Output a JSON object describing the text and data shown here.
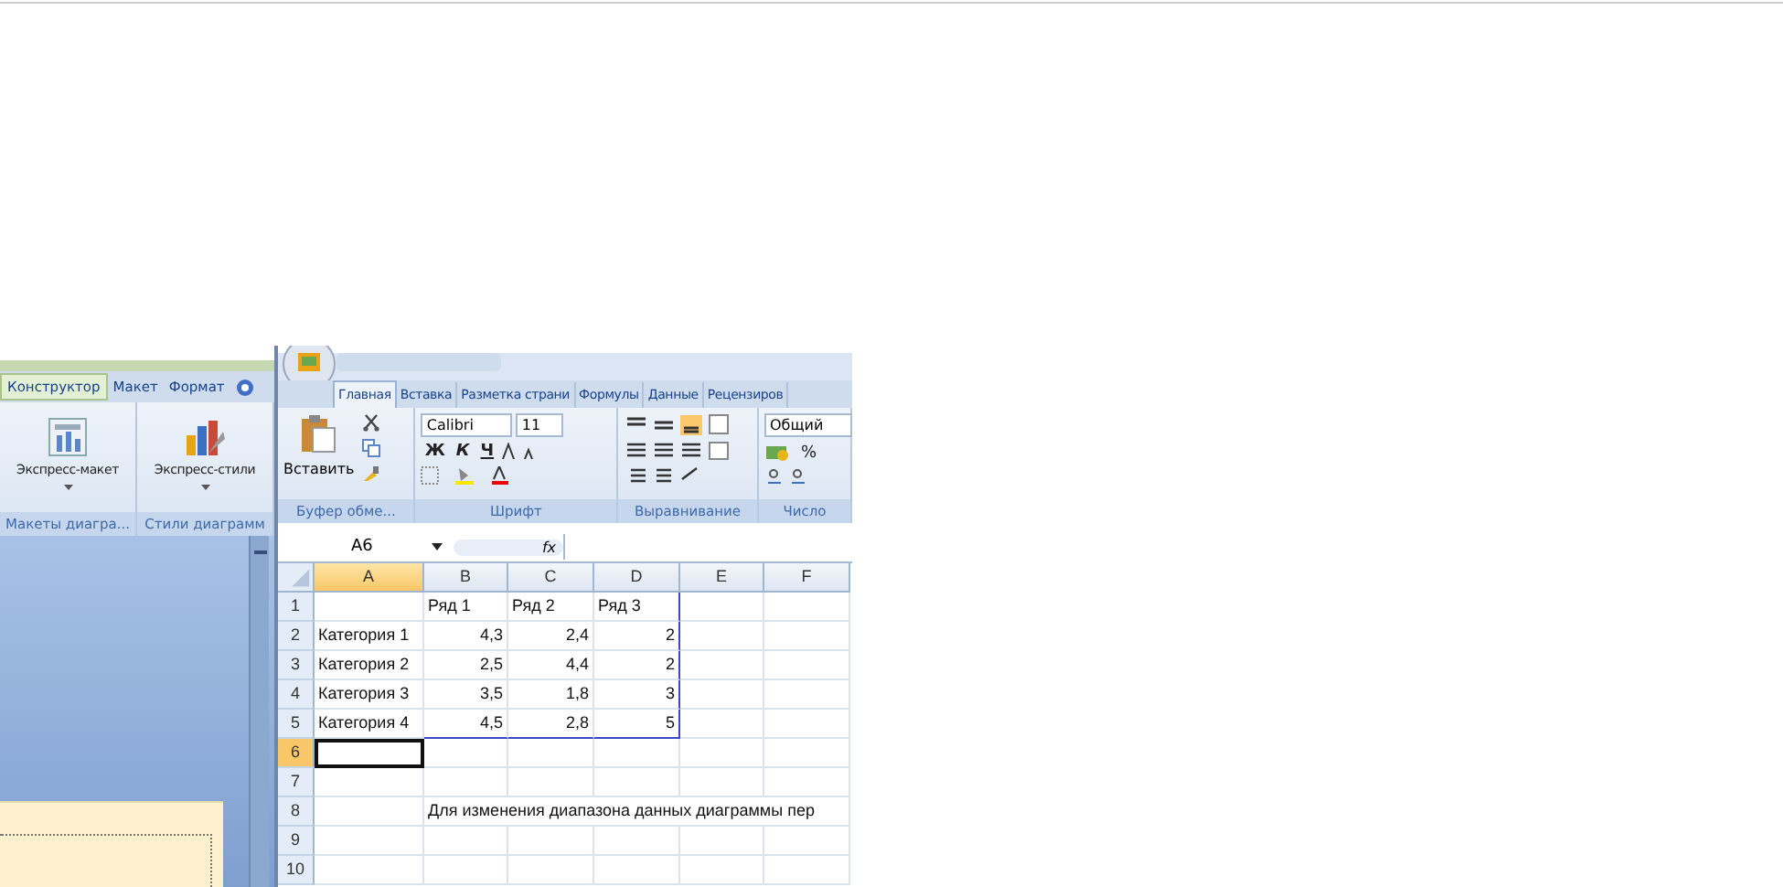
{
  "chart_panel": {
    "tabs": [
      {
        "label": "Конструктор",
        "selected": true
      },
      {
        "label": "Макет",
        "selected": false
      },
      {
        "label": "Формат",
        "selected": false
      }
    ],
    "buttons": [
      {
        "label": "Экспресс-макет",
        "kind": "layout"
      },
      {
        "label": "Экспресс-стили",
        "kind": "styles"
      }
    ],
    "groups": [
      "Макеты диагра...",
      "Стили диаграмм"
    ]
  },
  "excel": {
    "tabs": [
      {
        "label": "Главная",
        "selected": true
      },
      {
        "label": "Вставка",
        "selected": false
      },
      {
        "label": "Разметка страни",
        "selected": false
      },
      {
        "label": "Формулы",
        "selected": false
      },
      {
        "label": "Данные",
        "selected": false
      },
      {
        "label": "Рецензиров",
        "selected": false
      }
    ],
    "paste_label": "Вставить",
    "font_name": "Calibri",
    "font_size": "11",
    "bold": "Ж",
    "italic": "К",
    "underline": "Ч",
    "number_format": "Общий",
    "percent": "%",
    "groups": [
      "Буфер обме...",
      "Шрифт",
      "Выравнивание",
      "Число"
    ],
    "name_box": "A6",
    "fx": "fx",
    "columns": [
      {
        "label": "A",
        "selected": true
      },
      {
        "label": "B",
        "selected": false
      },
      {
        "label": "C",
        "selected": false
      },
      {
        "label": "D",
        "selected": false
      },
      {
        "label": "E",
        "selected": false
      },
      {
        "label": "F",
        "selected": false
      }
    ],
    "rows": [
      {
        "number": "1",
        "selected": false,
        "kind": "header",
        "values": [
          "Ряд 1",
          "Ряд 2",
          "Ряд 3"
        ]
      },
      {
        "number": "2",
        "selected": false,
        "kind": "data",
        "category": "Категория 1",
        "values": [
          "4,3",
          "2,4",
          "2"
        ]
      },
      {
        "number": "3",
        "selected": false,
        "kind": "data",
        "category": "Категория 2",
        "values": [
          "2,5",
          "4,4",
          "2"
        ]
      },
      {
        "number": "4",
        "selected": false,
        "kind": "data",
        "category": "Категория 3",
        "values": [
          "3,5",
          "1,8",
          "3"
        ]
      },
      {
        "number": "5",
        "selected": false,
        "kind": "data",
        "category": "Категория 4",
        "values": [
          "4,5",
          "2,8",
          "5"
        ]
      },
      {
        "number": "6",
        "selected": true,
        "kind": "empty"
      },
      {
        "number": "7",
        "selected": false,
        "kind": "empty"
      },
      {
        "number": "8",
        "selected": false,
        "kind": "note",
        "note": "Для изменения диапазона данных диаграммы пер"
      },
      {
        "number": "9",
        "selected": false,
        "kind": "empty"
      },
      {
        "number": "10",
        "selected": false,
        "kind": "empty"
      }
    ]
  }
}
